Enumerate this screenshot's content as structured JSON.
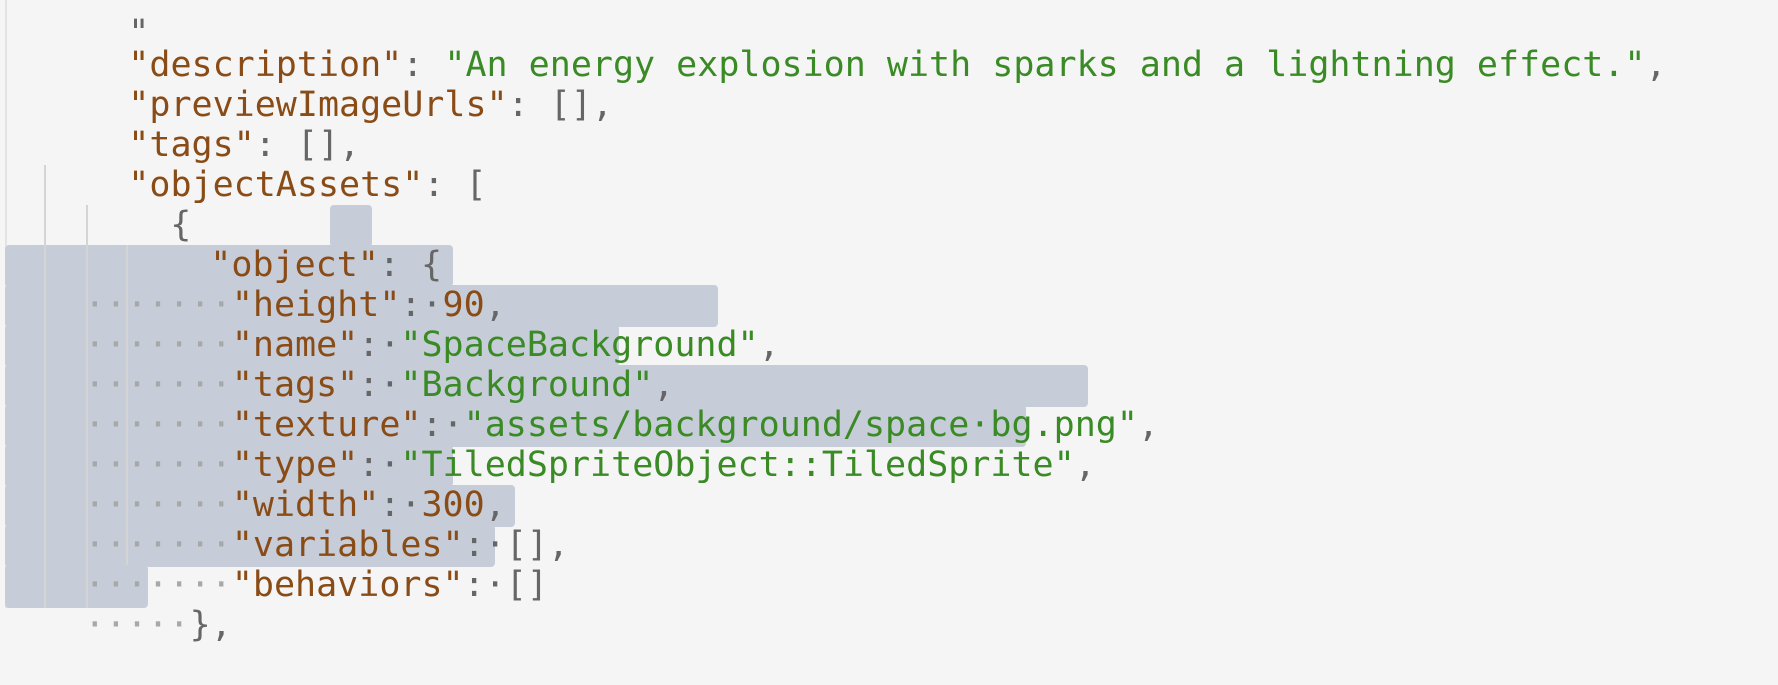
{
  "colors": {
    "background": "#f5f5f5",
    "selection": "#c7cdd8",
    "key": "#8a4c17",
    "string": "#3a8a25",
    "number": "#8a4c17",
    "punctuation": "#666666",
    "whitespace_marker": "#a8a8a8"
  },
  "editor": {
    "lines": [
      {
        "key": "\"description\"",
        "sep": ": ",
        "string": "\"An energy explosion with sparks and a lightning effect.\"",
        "tail": ","
      },
      {
        "key": "\"previewImageUrls\"",
        "sep": ": ",
        "punct": "[]",
        "tail": ","
      },
      {
        "key": "\"tags\"",
        "sep": ": ",
        "punct": "[]",
        "tail": ","
      },
      {
        "key": "\"objectAssets\"",
        "sep": ": ",
        "punct": "["
      },
      {
        "punct": "{"
      },
      {
        "key": "\"object\"",
        "sep": ": ",
        "punct": "{"
      },
      {
        "ws": "·······",
        "key": "\"height\"",
        "sep": ":·",
        "number": "90",
        "tail": ","
      },
      {
        "ws": "·······",
        "key": "\"name\"",
        "sep": ":·",
        "string": "\"SpaceBackground\"",
        "tail": ","
      },
      {
        "ws": "·······",
        "key": "\"tags\"",
        "sep": ":·",
        "string": "\"Background\"",
        "tail": ","
      },
      {
        "ws": "·······",
        "key": "\"texture\"",
        "sep": ":·",
        "string": "\"assets/background/space·bg.png\"",
        "tail": ","
      },
      {
        "ws": "·······",
        "key": "\"type\"",
        "sep": ":·",
        "string": "\"TiledSpriteObject::TiledSprite\"",
        "tail": ","
      },
      {
        "ws": "·······",
        "key": "\"width\"",
        "sep": ":·",
        "number": "300",
        "tail": ","
      },
      {
        "ws": "·······",
        "key": "\"variables\"",
        "sep": ":·",
        "punct": "[]",
        "tail": ","
      },
      {
        "ws": "·······",
        "key": "\"behaviors\"",
        "sep": ":·",
        "punct": "[]"
      },
      {
        "ws": "·····",
        "punct": "}",
        "tail": ","
      }
    ]
  }
}
